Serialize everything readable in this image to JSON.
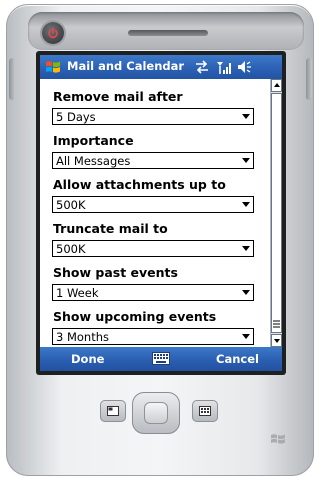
{
  "titlebar": {
    "title": "Mail and Calendar",
    "icons": [
      "windows-logo-icon",
      "sync-icon",
      "signal-icon",
      "speaker-icon"
    ]
  },
  "fields": [
    {
      "label": "Remove mail after",
      "value": "5 Days"
    },
    {
      "label": "Importance",
      "value": "All Messages"
    },
    {
      "label": "Allow attachments up to",
      "value": "500K"
    },
    {
      "label": "Truncate mail to",
      "value": "500K"
    },
    {
      "label": "Show past events",
      "value": "1 Week"
    },
    {
      "label": "Show upcoming events",
      "value": "3 Months"
    }
  ],
  "softkeys": {
    "left": "Done",
    "center_icon": "keyboard-icon",
    "right": "Cancel"
  },
  "colors": {
    "titlebar": "#2c61b5",
    "softbar": "#2b5fb2",
    "device_body": "#eef0f2",
    "text": "#000000"
  }
}
